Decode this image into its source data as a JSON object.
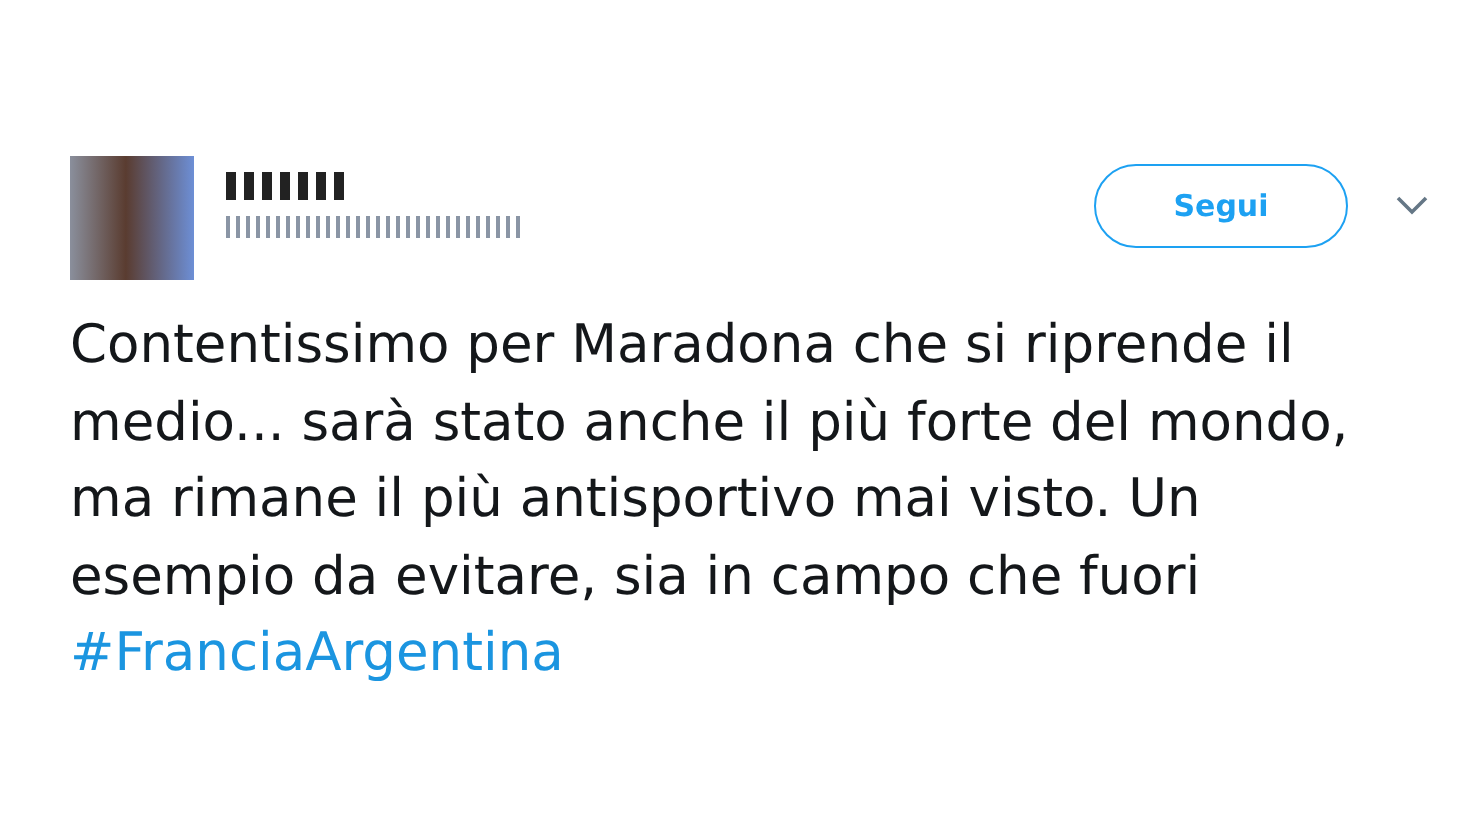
{
  "tweet": {
    "follow_button": "Segui",
    "text": "Contentissimo per Maradona che si riprende il medio... sarà stato anche il più forte del mondo, ma rimane il più antisportivo mai visto. Un esempio da evitare, sia in campo che fuori",
    "hashtag": "#FranciaArgentina"
  }
}
